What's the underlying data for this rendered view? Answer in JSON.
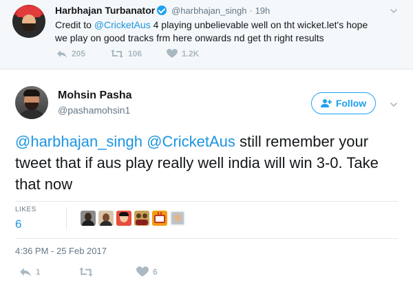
{
  "parent_tweet": {
    "name": "Harbhajan Turbanator",
    "handle": "@harbhajan_singh",
    "separator": "·",
    "time": "19h",
    "text_prefix": "Credit to ",
    "mention": "@CricketAus",
    "text_suffix": " 4 playing unbelievable well on tht wicket.let's hope we play on good tracks frm here onwards nd get th right results",
    "reply_count": "205",
    "retweet_count": "106",
    "like_count": "1.2K"
  },
  "main_tweet": {
    "name": "Mohsin Pasha",
    "handle": "@pashamohsin1",
    "follow_label": "Follow",
    "mention_1": "@harbhajan_singh",
    "mention_2": "@CricketAus",
    "text_rest": " still remember your tweet that if aus play really well india will win 3-0. Take that now",
    "likes_label": "LIKES",
    "likes_count": "6",
    "timestamp": "4:36 PM - 25 Feb 2017",
    "reply_count": "1",
    "retweet_count": "",
    "like_count": "6"
  },
  "icons": {
    "reply": "reply-icon",
    "retweet": "retweet-icon",
    "like": "heart-icon",
    "more": "chevron-down-icon",
    "follow": "add-user-icon",
    "verified": "verified-badge-icon"
  },
  "colors": {
    "accent": "#1da1f2",
    "link": "#1b95e0",
    "muted": "#657786",
    "action_gray": "#aab8c2",
    "parent_bg": "#f5f8fa"
  }
}
